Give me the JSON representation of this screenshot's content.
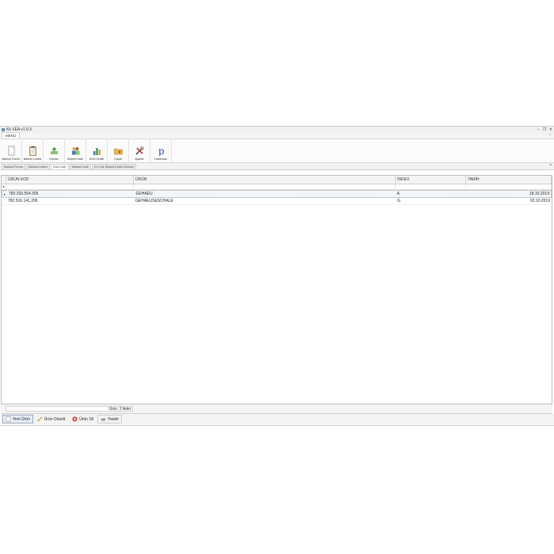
{
  "window": {
    "title": "Kk VEA v1.0.3"
  },
  "menu": {
    "tab": "MENÜ"
  },
  "ribbon": [
    {
      "label": "Barkod Formu",
      "icon": "document-icon"
    },
    {
      "label": "Barkod Listesi",
      "icon": "clipboard-icon"
    },
    {
      "label": "Ürünler",
      "icon": "add-product-icon"
    },
    {
      "label": "Müşteri Kartı",
      "icon": "customers-icon"
    },
    {
      "label": "Ürün Grafik",
      "icon": "bar-chart-icon"
    },
    {
      "label": "Kapat",
      "icon": "folder-icon"
    },
    {
      "label": "Ayarlar",
      "icon": "tools-icon"
    },
    {
      "label": "Hakkında",
      "icon": "p-logo-icon"
    }
  ],
  "doc_tabs": [
    "Barkod Formu",
    "Barkod Listesi",
    "Ürün Ekle",
    "Müşteri Kartı",
    "En Çok Sipariş Edilen Ürünler"
  ],
  "grid": {
    "headers": [
      "ÜRÜN KOD",
      "ÜRÜN",
      "İNDEX",
      "TARİH"
    ],
    "rows": [
      [
        "783.333.554.305",
        "GEHAEU",
        "A",
        "18.10.2019"
      ],
      [
        "782.516.141.206",
        "GEHAEUSESCHALE",
        "G",
        "02.10.2019"
      ]
    ]
  },
  "status": {
    "count": "Ürün: 2 Adet"
  },
  "actions": {
    "new": "Yeni Ürün",
    "edit": "Ürün Düzelt",
    "delete": "Ürün Sil",
    "print": "Yazdır"
  },
  "colors": {
    "accent": "#6a8cbf",
    "delete": "#c0392b"
  }
}
